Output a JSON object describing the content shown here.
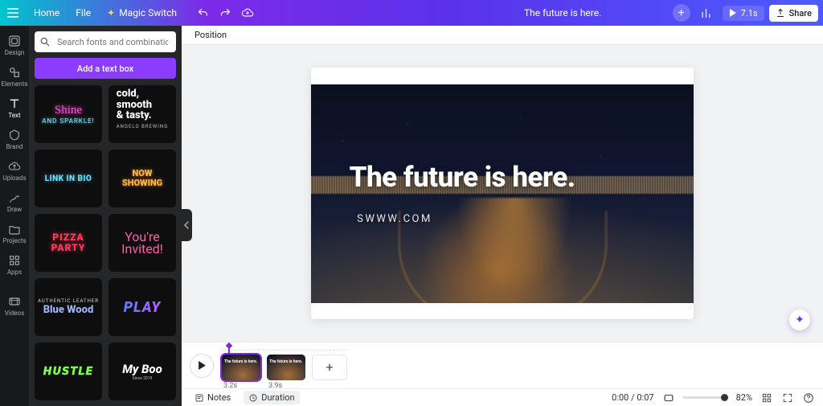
{
  "topbar": {
    "home": "Home",
    "file": "File",
    "magic": "Magic Switch",
    "title": "The future is here.",
    "play_time": "7.1s",
    "share": "Share"
  },
  "rail": [
    {
      "id": "design",
      "label": "Design"
    },
    {
      "id": "elements",
      "label": "Elements"
    },
    {
      "id": "text",
      "label": "Text"
    },
    {
      "id": "brand",
      "label": "Brand"
    },
    {
      "id": "uploads",
      "label": "Uploads"
    },
    {
      "id": "draw",
      "label": "Draw"
    },
    {
      "id": "projects",
      "label": "Projects"
    },
    {
      "id": "apps",
      "label": "Apps"
    },
    {
      "id": "videos",
      "label": "Videos"
    }
  ],
  "panel": {
    "search_placeholder": "Search fonts and combinations",
    "add_text": "Add a text box",
    "styles": [
      {
        "id": "shine",
        "line1": "Shine",
        "line2": "AND SPARKLE!"
      },
      {
        "id": "tasty",
        "line1": "cold,",
        "line2": "smooth",
        "line3": "& tasty.",
        "caption": "ANGELO BREWING"
      },
      {
        "id": "linkbio",
        "line1": "LINK IN BIO"
      },
      {
        "id": "nowshowing",
        "line1": "NOW",
        "line2": "SHOWING"
      },
      {
        "id": "pizza",
        "line1": "PIZZA",
        "line2": "PARTY"
      },
      {
        "id": "invited",
        "line1": "You're",
        "line2": "Invited!"
      },
      {
        "id": "bluewood",
        "line1": "AUTHENTIC LEATHER",
        "line2": "Blue Wood"
      },
      {
        "id": "play",
        "line1": "PLAY"
      },
      {
        "id": "hustle",
        "line1": "HUSTLE"
      },
      {
        "id": "myboo",
        "line1": "My Boo",
        "line2": "Since 2019"
      }
    ]
  },
  "toolbar": {
    "position": "Position"
  },
  "slide": {
    "headline": "The future is here.",
    "subline": "SWWW.COM"
  },
  "timeline": {
    "clips": [
      {
        "time": "3.2s",
        "selected": true,
        "text": "The future is here."
      },
      {
        "time": "3.9s",
        "selected": false,
        "text": "The future is here."
      }
    ]
  },
  "bottom": {
    "notes": "Notes",
    "duration": "Duration",
    "timecode": "0:00 / 0:07",
    "zoom": "82%"
  }
}
